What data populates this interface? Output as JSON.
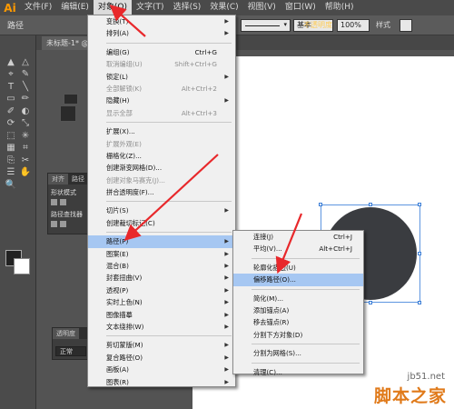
{
  "app": {
    "logo": "Ai"
  },
  "menubar": {
    "items": [
      "文件(F)",
      "编辑(E)",
      "对象(O)",
      "文字(T)",
      "选择(S)",
      "效果(C)",
      "视图(V)",
      "窗口(W)",
      "帮助(H)"
    ]
  },
  "controlbar": {
    "label": "路径",
    "stroke_style": "基本",
    "opacity_label": "不透明度",
    "opacity_value": "100%",
    "style_label": "样式"
  },
  "document": {
    "tab": "未标题-1* @"
  },
  "panels": {
    "align": {
      "tabs": [
        "对齐",
        "路径"
      ],
      "row1": "形状模式",
      "row2": "路径查找器"
    },
    "transparency": {
      "tab": "透明度",
      "mode": "正常"
    }
  },
  "object_menu": {
    "items": [
      {
        "label": "变换(T)",
        "shortcut": "",
        "submenu": true,
        "disabled": false
      },
      {
        "label": "排列(A)",
        "shortcut": "",
        "submenu": true,
        "disabled": false
      },
      {
        "sep": true
      },
      {
        "label": "编组(G)",
        "shortcut": "Ctrl+G",
        "submenu": false,
        "disabled": false
      },
      {
        "label": "取消编组(U)",
        "shortcut": "Shift+Ctrl+G",
        "submenu": false,
        "disabled": true
      },
      {
        "label": "锁定(L)",
        "shortcut": "",
        "submenu": true,
        "disabled": false
      },
      {
        "label": "全部解锁(K)",
        "shortcut": "Alt+Ctrl+2",
        "submenu": false,
        "disabled": true
      },
      {
        "label": "隐藏(H)",
        "shortcut": "",
        "submenu": true,
        "disabled": false
      },
      {
        "label": "显示全部",
        "shortcut": "Alt+Ctrl+3",
        "submenu": false,
        "disabled": true
      },
      {
        "sep": true
      },
      {
        "label": "扩展(X)...",
        "shortcut": "",
        "submenu": false,
        "disabled": false
      },
      {
        "label": "扩展外观(E)",
        "shortcut": "",
        "submenu": false,
        "disabled": true
      },
      {
        "label": "栅格化(Z)...",
        "shortcut": "",
        "submenu": false,
        "disabled": false
      },
      {
        "label": "创建渐变网格(D)...",
        "shortcut": "",
        "submenu": false,
        "disabled": false
      },
      {
        "label": "创建对象马赛克(J)...",
        "shortcut": "",
        "submenu": false,
        "disabled": true
      },
      {
        "label": "拼合透明度(F)...",
        "shortcut": "",
        "submenu": false,
        "disabled": false
      },
      {
        "sep": true
      },
      {
        "label": "切片(S)",
        "shortcut": "",
        "submenu": true,
        "disabled": false
      },
      {
        "label": "创建裁切标记(C)",
        "shortcut": "",
        "submenu": false,
        "disabled": false
      },
      {
        "sep": true
      },
      {
        "label": "路径(P)",
        "shortcut": "",
        "submenu": true,
        "disabled": false,
        "highlight": true
      },
      {
        "label": "图案(E)",
        "shortcut": "",
        "submenu": true,
        "disabled": false
      },
      {
        "label": "混合(B)",
        "shortcut": "",
        "submenu": true,
        "disabled": false
      },
      {
        "label": "封套扭曲(V)",
        "shortcut": "",
        "submenu": true,
        "disabled": false
      },
      {
        "label": "透视(P)",
        "shortcut": "",
        "submenu": true,
        "disabled": false
      },
      {
        "label": "实时上色(N)",
        "shortcut": "",
        "submenu": true,
        "disabled": false
      },
      {
        "label": "图像描摹",
        "shortcut": "",
        "submenu": true,
        "disabled": false
      },
      {
        "label": "文本绕排(W)",
        "shortcut": "",
        "submenu": true,
        "disabled": false
      },
      {
        "sep": true
      },
      {
        "label": "剪切蒙版(M)",
        "shortcut": "",
        "submenu": true,
        "disabled": false
      },
      {
        "label": "复合路径(O)",
        "shortcut": "",
        "submenu": true,
        "disabled": false
      },
      {
        "label": "画板(A)",
        "shortcut": "",
        "submenu": true,
        "disabled": false
      },
      {
        "label": "图表(R)",
        "shortcut": "",
        "submenu": true,
        "disabled": false
      }
    ]
  },
  "path_submenu": {
    "items": [
      {
        "label": "连接(J)",
        "shortcut": "Ctrl+J"
      },
      {
        "label": "平均(V)...",
        "shortcut": "Alt+Ctrl+J"
      },
      {
        "sep": true
      },
      {
        "label": "轮廓化描边(U)",
        "shortcut": ""
      },
      {
        "label": "偏移路径(O)...",
        "shortcut": "",
        "highlight": true
      },
      {
        "sep": true
      },
      {
        "label": "简化(M)...",
        "shortcut": ""
      },
      {
        "label": "添加锚点(A)",
        "shortcut": ""
      },
      {
        "label": "移去锚点(R)",
        "shortcut": ""
      },
      {
        "label": "分割下方对象(D)",
        "shortcut": ""
      },
      {
        "sep": true
      },
      {
        "label": "分割为网格(S)...",
        "shortcut": ""
      },
      {
        "sep": true
      },
      {
        "label": "清理(C)...",
        "shortcut": ""
      }
    ]
  },
  "watermark": {
    "url": "jb51.net",
    "text": "脚本之家"
  },
  "colors": {
    "highlight": "#a6c7f2",
    "annotation_arrow": "#e8282b",
    "shape_fill": "#3a3c40"
  }
}
